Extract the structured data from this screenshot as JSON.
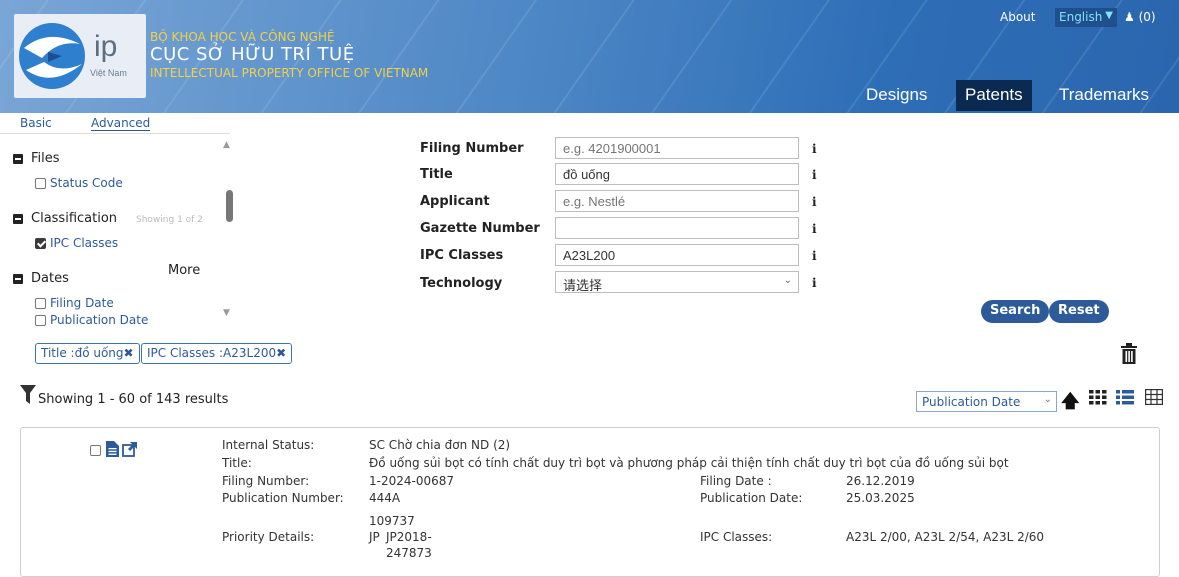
{
  "header": {
    "logo_ip": "ip",
    "logo_country": "Việt Nam",
    "org_line1": "BỘ KHOA HỌC VÀ CÔNG NGHỆ",
    "org_line2": "CỤC SỞ HỮU TRÍ TUỆ",
    "org_line3": "INTELLECTUAL PROPERTY OFFICE OF VIETNAM",
    "about": "About",
    "language": "English",
    "cart": "(0)",
    "tabs": [
      {
        "label": "Designs",
        "active": false
      },
      {
        "label": "Patents",
        "active": true
      },
      {
        "label": "Trademarks",
        "active": false
      }
    ],
    "colors": {
      "active_tab": "#0b2a52",
      "accent": "#2d5b9a",
      "gold": "#f2d04a"
    }
  },
  "search_mode": {
    "basic": "Basic",
    "advanced": "Advanced"
  },
  "filters": {
    "files": {
      "label": "Files",
      "items": [
        {
          "label": "Status Code",
          "checked": false
        }
      ]
    },
    "classification": {
      "label": "Classification",
      "showing": "Showing 1 of 2",
      "items": [
        {
          "label": "IPC Classes",
          "checked": true
        }
      ]
    },
    "dates": {
      "label": "Dates",
      "more": "More",
      "items": [
        {
          "label": "Filing Date",
          "checked": false
        },
        {
          "label": "Publication Date",
          "checked": false
        }
      ]
    }
  },
  "form": {
    "filing_number": {
      "label": "Filing Number",
      "value": "",
      "placeholder": "e.g. 4201900001"
    },
    "title": {
      "label": "Title",
      "value": "đồ uống"
    },
    "applicant": {
      "label": "Applicant",
      "value": "",
      "placeholder": "e.g. Nestlé"
    },
    "gazette_number": {
      "label": "Gazette Number",
      "value": ""
    },
    "ipc_classes": {
      "label": "IPC Classes",
      "value": "A23L200"
    },
    "technology": {
      "label": "Technology",
      "value": "请选择"
    },
    "info_icon": "i",
    "search": "Search",
    "reset": "Reset"
  },
  "chips": [
    {
      "label": "Title :đồ uống"
    },
    {
      "label": "IPC Classes :A23L200"
    }
  ],
  "chip_close": "✖",
  "results": {
    "summary": "Showing 1 - 60 of 143 results",
    "sort_by": "Publication Date",
    "sort_direction": "ascending"
  },
  "record": {
    "internal_status_label": "Internal Status:",
    "internal_status": "SC Chờ chia đơn ND (2)",
    "title_label": "Title:",
    "title": "Đồ uống sủi bọt có tính chất duy trì bọt và phương pháp cải thiện tính chất duy trì bọt của đồ uống sủi bọt",
    "filing_number_label": "Filing Number:",
    "filing_number": "1-2024-00687",
    "filing_date_label": "Filing Date :",
    "filing_date": "26.12.2019",
    "publication_number_label": "Publication Number:",
    "publication_number": "444A",
    "publication_date_label": "Publication Date:",
    "publication_date": "25.03.2025",
    "extra_number": "109737",
    "priority_label": "Priority Details:",
    "priority_country": "JP",
    "priority_number_1": "JP2018-",
    "priority_number_2": "247873",
    "ipc_label": "IPC Classes:",
    "ipc_values": "A23L 2/00, A23L 2/54, A23L 2/60"
  }
}
